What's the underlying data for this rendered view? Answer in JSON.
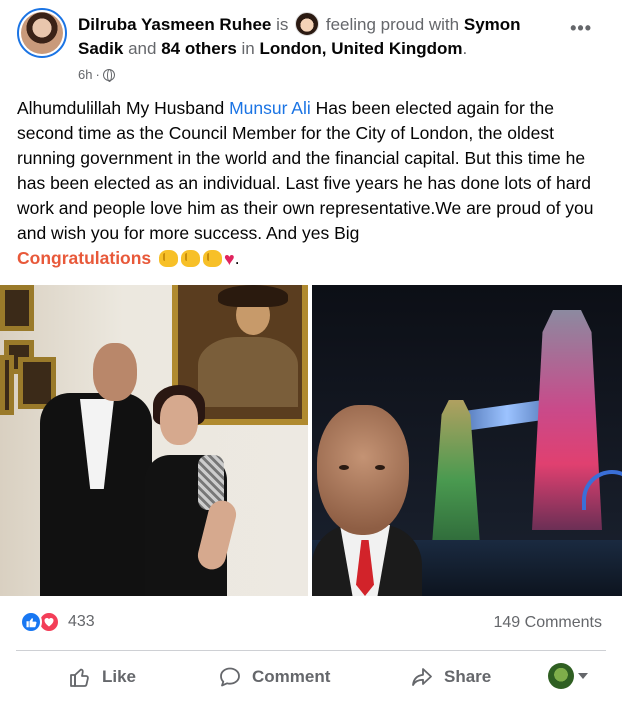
{
  "post": {
    "author": "Dilruba Yasmeen Ruhee",
    "connector_is": "is",
    "feeling": "feeling proud with",
    "tagged_name": "Symon Sadik",
    "connector_and": "and",
    "others": "84 others",
    "connector_in": "in",
    "location": "London, United Kingdom",
    "location_end": ".",
    "time": "6h",
    "time_sep": "·",
    "more_icon": "more-horizontal-icon",
    "text_before": "Alhumdulillah My Husband ",
    "mention": "Munsur Ali",
    "text_after": "  Has been elected again for the second time as the Council Member for the City of London, the oldest running government in the world and the financial capital. But this time he has been elected as an individual. Last five years he has done lots of hard work and people love him as their own representative.We are proud of you and wish you for more success. And yes Big",
    "congrats_word": "Congratulations",
    "text_end": "."
  },
  "stats": {
    "reaction_count": "433",
    "comments": "149 Comments"
  },
  "actions": {
    "like": "Like",
    "comment": "Comment",
    "share": "Share"
  },
  "colors": {
    "link": "#1b74e4",
    "congrats": "#e8593a",
    "like_blue": "#1877f2",
    "love_red": "#f33e58",
    "muted": "#65676b"
  }
}
